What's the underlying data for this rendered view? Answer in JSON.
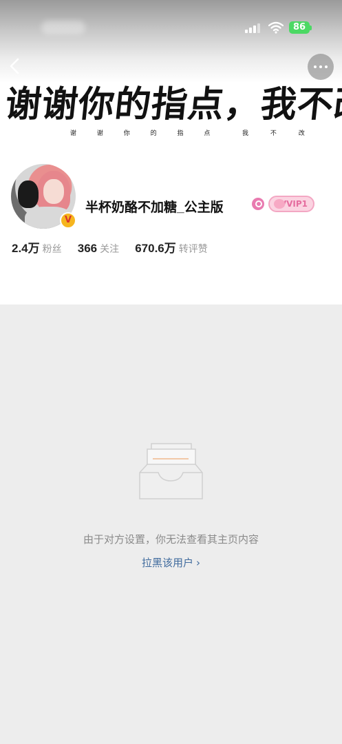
{
  "status_bar": {
    "battery_level": "86",
    "battery_color": "#4cd964",
    "icons": [
      "signal-icon",
      "wifi-icon",
      "battery-icon"
    ]
  },
  "header": {
    "back_icon": "chevron-left-icon",
    "more_icon": "more-dots-icon"
  },
  "cover": {
    "calligraphy": "谢谢你的指点，我不改",
    "subtitle_chars": [
      "谢",
      "谢",
      "你",
      "的",
      "指",
      "点",
      "我",
      "不",
      "改"
    ]
  },
  "profile": {
    "username": "半杯奶酪不加糖_公主版",
    "verified_mark": "V",
    "vip_label": "VVIP1",
    "stats": [
      {
        "value": "2.4万",
        "label": "粉丝"
      },
      {
        "value": "366",
        "label": "关注"
      },
      {
        "value": "670.6万",
        "label": "转评赞"
      }
    ]
  },
  "empty_state": {
    "message": "由于对方设置，你无法查看其主页内容",
    "action_label": "拉黑该用户",
    "action_color": "#3f6a9d"
  }
}
